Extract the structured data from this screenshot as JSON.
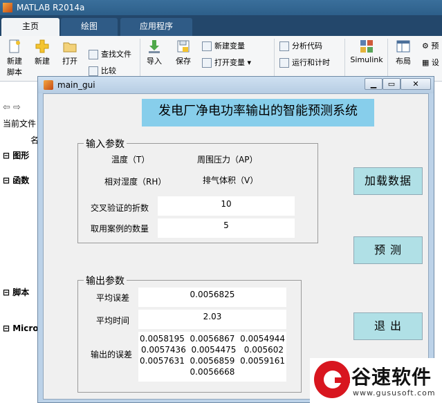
{
  "app": {
    "title": "MATLAB R2014a",
    "tabs": [
      "主页",
      "绘图",
      "应用程序"
    ]
  },
  "ribbon": {
    "new_script": "新建\n脚本",
    "new": "新建",
    "open": "打开",
    "find_files": "查找文件",
    "compare": "比较",
    "import": "导入",
    "save": "保存",
    "new_variable": "新建变量",
    "open_variable": "打开变量",
    "analyze_code": "分析代码",
    "run_and_time": "运行和计时",
    "simulink": "Simulink",
    "layout": "布局",
    "pref_fragment": "预",
    "set_fragment": "设"
  },
  "sidebar": {
    "toolbar_arrows": "⇦ ⇨",
    "current_folder": "当前文件",
    "name_col": "名",
    "sections": [
      "图形",
      "函数",
      "脚本",
      "Micro"
    ]
  },
  "figure": {
    "window_title": "main_gui",
    "main_title": "发电厂净电功率输出的智能预测系统",
    "input_group": {
      "title": "输入参数",
      "temperature": "温度（T）",
      "ambient_pressure": "周围压力（AP）",
      "relative_humidity": "相对湿度（RH）",
      "exhaust_volume": "排气体积（V）",
      "folds_label": "交叉验证的折数",
      "folds_value": "10",
      "cases_label": "取用案例的数量",
      "cases_value": "5"
    },
    "output_group": {
      "title": "输出参数",
      "avg_error_label": "平均误差",
      "avg_error_value": "0.0056825",
      "avg_time_label": "平均时间",
      "avg_time_value": "2.03",
      "output_errors_label": "输出的误差",
      "output_errors_rows": [
        "0.0058195  0.0056867  0.0054944",
        "0.0057436  0.0054475   0.005602",
        "0.0057631  0.0056859  0.0059161",
        "0.0056668"
      ]
    },
    "buttons": {
      "load": "加载数据",
      "predict": "预 测",
      "exit": "退 出"
    }
  },
  "watermark": {
    "name": "谷速软件",
    "url": "www.gususoft.com"
  },
  "colors": {
    "title_bg": "#87ceeb",
    "button_bg": "#b0e0e6",
    "panel_bg": "#f0f0f0"
  }
}
